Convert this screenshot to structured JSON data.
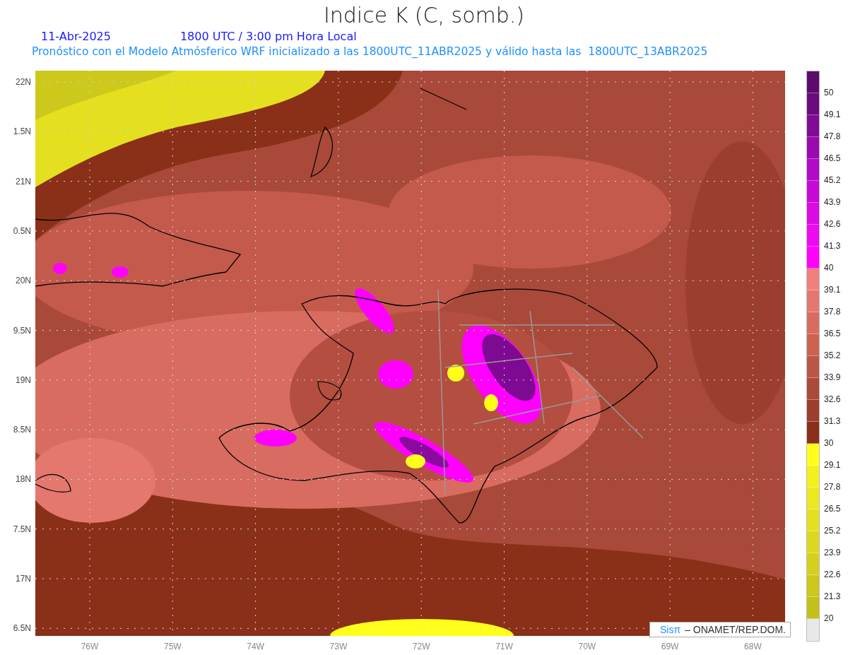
{
  "title": "Indice K (C, somb.)",
  "date": "11-Abr-2025",
  "time": "1800 UTC / 3:00 pm Hora Local",
  "subtitle": "Pronóstico con el Modelo Atmósferico WRF inicializado a las 1800UTC_11ABR2025 y válido hasta las  1800UTC_13ABR2025",
  "lat_labels": [
    "22N",
    "1.5N",
    "21N",
    "0.5N",
    "20N",
    "9.5N",
    "19N",
    "8.5N",
    "18N",
    "7.5N",
    "17N",
    "6.5N"
  ],
  "lon_labels": [
    "76W",
    "75W",
    "74W",
    "73W",
    "72W",
    "71W",
    "70W",
    "69W",
    "68W"
  ],
  "credit": {
    "brand": "Sisπ",
    "text": "– ONAMET/REP.DOM."
  },
  "legend": [
    {
      "color": "#5c0a6c",
      "label": "50"
    },
    {
      "color": "#6c0a80",
      "label": "49.1"
    },
    {
      "color": "#820a96",
      "label": "47.8"
    },
    {
      "color": "#9a0aae",
      "label": "46.5"
    },
    {
      "color": "#b20ac6",
      "label": "45.2"
    },
    {
      "color": "#c80ad6",
      "label": "43.9"
    },
    {
      "color": "#dc0ae4",
      "label": "42.6"
    },
    {
      "color": "#ec0af0",
      "label": "41.3"
    },
    {
      "color": "#ff00ff",
      "label": "40"
    },
    {
      "color": "#f08080",
      "label": "39.1"
    },
    {
      "color": "#e4786e",
      "label": "37.8"
    },
    {
      "color": "#d86c60",
      "label": "36.5"
    },
    {
      "color": "#cc6252",
      "label": "35.2"
    },
    {
      "color": "#bc5646",
      "label": "33.9"
    },
    {
      "color": "#ac4a3a",
      "label": "32.6"
    },
    {
      "color": "#9c3e2e",
      "label": "31.3"
    },
    {
      "color": "#8a3018",
      "label": "30"
    },
    {
      "color": "#ffff1a",
      "label": "29.1"
    },
    {
      "color": "#f4f01e",
      "label": "27.8"
    },
    {
      "color": "#ece820",
      "label": "26.5"
    },
    {
      "color": "#e4e020",
      "label": "25.2"
    },
    {
      "color": "#dcd820",
      "label": "23.9"
    },
    {
      "color": "#d4d01e",
      "label": "22.6"
    },
    {
      "color": "#ccc81c",
      "label": "21.3"
    },
    {
      "color": "#c4c01a",
      "label": "20"
    },
    {
      "color": "#e8e8e8"
    }
  ]
}
